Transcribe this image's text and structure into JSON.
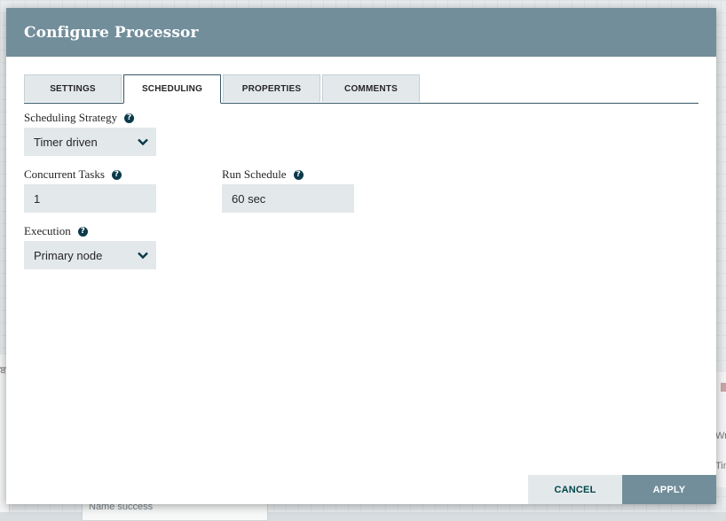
{
  "background": {
    "bottom_text": "Name  success",
    "left_text": "ਬ",
    "right_text_1": "Wri",
    "right_text_2": "Tin"
  },
  "dialog": {
    "title": "Configure Processor",
    "header_color": "#728e9b"
  },
  "tabs": [
    {
      "label": "SETTINGS",
      "active": false
    },
    {
      "label": "SCHEDULING",
      "active": true
    },
    {
      "label": "PROPERTIES",
      "active": false
    },
    {
      "label": "COMMENTS",
      "active": false
    }
  ],
  "fields": {
    "scheduling_strategy": {
      "label": "Scheduling Strategy",
      "value": "Timer driven"
    },
    "concurrent_tasks": {
      "label": "Concurrent Tasks",
      "value": "1"
    },
    "run_schedule": {
      "label": "Run Schedule",
      "value": "60 sec"
    },
    "execution": {
      "label": "Execution",
      "value": "Primary node"
    }
  },
  "icons": {
    "help": "question-circle-icon",
    "dropdown": "chevron-down-icon"
  },
  "buttons": {
    "cancel": "CANCEL",
    "apply": "APPLY"
  }
}
